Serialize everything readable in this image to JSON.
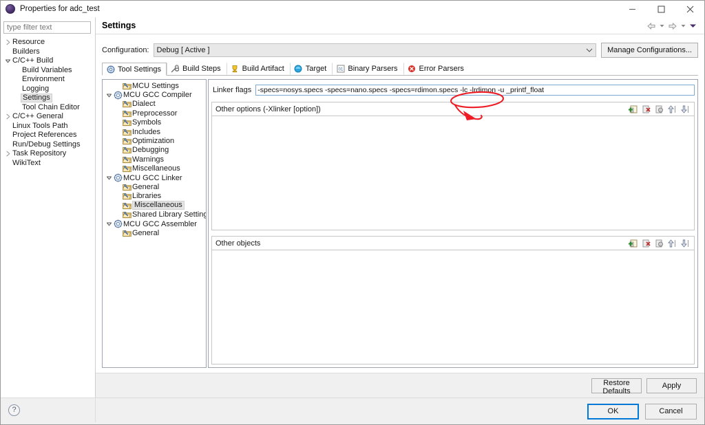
{
  "window": {
    "title": "Properties for adc_test",
    "icon": "eclipse-circle-icon",
    "controls": {
      "minimize": "minimize-icon",
      "maximize": "maximize-icon",
      "close": "close-icon"
    }
  },
  "sidebar": {
    "filter": {
      "placeholder": "type filter text",
      "value": ""
    },
    "items": [
      {
        "label": "Resource",
        "indent": 0,
        "twisty": "collapsed",
        "selected": false
      },
      {
        "label": "Builders",
        "indent": 0,
        "twisty": "none",
        "selected": false
      },
      {
        "label": "C/C++ Build",
        "indent": 0,
        "twisty": "expanded",
        "selected": false
      },
      {
        "label": "Build Variables",
        "indent": 1,
        "twisty": "none",
        "selected": false
      },
      {
        "label": "Environment",
        "indent": 1,
        "twisty": "none",
        "selected": false
      },
      {
        "label": "Logging",
        "indent": 1,
        "twisty": "none",
        "selected": false
      },
      {
        "label": "Settings",
        "indent": 1,
        "twisty": "none",
        "selected": true
      },
      {
        "label": "Tool Chain Editor",
        "indent": 1,
        "twisty": "none",
        "selected": false
      },
      {
        "label": "C/C++ General",
        "indent": 0,
        "twisty": "collapsed",
        "selected": false
      },
      {
        "label": "Linux Tools Path",
        "indent": 0,
        "twisty": "none",
        "selected": false
      },
      {
        "label": "Project References",
        "indent": 0,
        "twisty": "none",
        "selected": false
      },
      {
        "label": "Run/Debug Settings",
        "indent": 0,
        "twisty": "none",
        "selected": false
      },
      {
        "label": "Task Repository",
        "indent": 0,
        "twisty": "collapsed",
        "selected": false
      },
      {
        "label": "WikiText",
        "indent": 0,
        "twisty": "none",
        "selected": false
      }
    ],
    "help_icon": "help-question-icon"
  },
  "page": {
    "title": "Settings",
    "nav": {
      "back_icon": "arrow-left-icon",
      "back_menu_icon": "chevron-down-icon",
      "forward_icon": "arrow-right-icon",
      "forward_menu_icon": "chevron-down-icon",
      "menu_icon": "chevron-down-filled-icon"
    }
  },
  "configuration": {
    "label": "Configuration:",
    "value": "Debug  [ Active ]",
    "dropdown_icon": "chevron-down-icon",
    "manage_button": "Manage Configurations..."
  },
  "tabs": [
    {
      "label": "Tool Settings",
      "icon": "tool-settings-icon",
      "active": true
    },
    {
      "label": "Build Steps",
      "icon": "wrench-icon",
      "active": false
    },
    {
      "label": "Build Artifact",
      "icon": "trophy-icon",
      "active": false
    },
    {
      "label": "Target",
      "icon": "target-icon",
      "active": false
    },
    {
      "label": "Binary Parsers",
      "icon": "binary-parsers-icon",
      "active": false
    },
    {
      "label": "Error Parsers",
      "icon": "error-parsers-icon",
      "active": false
    }
  ],
  "tool_tree": [
    {
      "label": "MCU Settings",
      "indent": 1,
      "twisty": "none",
      "icon": "folder-tool-icon",
      "selected": false
    },
    {
      "label": "MCU GCC Compiler",
      "indent": 0,
      "twisty": "expanded",
      "icon": "gear-tool-icon",
      "selected": false
    },
    {
      "label": "Dialect",
      "indent": 1,
      "twisty": "none",
      "icon": "folder-tool-icon",
      "selected": false
    },
    {
      "label": "Preprocessor",
      "indent": 1,
      "twisty": "none",
      "icon": "folder-tool-icon",
      "selected": false
    },
    {
      "label": "Symbols",
      "indent": 1,
      "twisty": "none",
      "icon": "folder-tool-icon",
      "selected": false
    },
    {
      "label": "Includes",
      "indent": 1,
      "twisty": "none",
      "icon": "folder-tool-icon",
      "selected": false
    },
    {
      "label": "Optimization",
      "indent": 1,
      "twisty": "none",
      "icon": "folder-tool-icon",
      "selected": false
    },
    {
      "label": "Debugging",
      "indent": 1,
      "twisty": "none",
      "icon": "folder-tool-icon",
      "selected": false
    },
    {
      "label": "Warnings",
      "indent": 1,
      "twisty": "none",
      "icon": "folder-tool-icon",
      "selected": false
    },
    {
      "label": "Miscellaneous",
      "indent": 1,
      "twisty": "none",
      "icon": "folder-tool-icon",
      "selected": false
    },
    {
      "label": "MCU GCC Linker",
      "indent": 0,
      "twisty": "expanded",
      "icon": "gear-tool-icon",
      "selected": false
    },
    {
      "label": "General",
      "indent": 1,
      "twisty": "none",
      "icon": "folder-tool-icon",
      "selected": false
    },
    {
      "label": "Libraries",
      "indent": 1,
      "twisty": "none",
      "icon": "folder-tool-icon",
      "selected": false
    },
    {
      "label": "Miscellaneous",
      "indent": 1,
      "twisty": "none",
      "icon": "folder-tool-icon",
      "selected": true
    },
    {
      "label": "Shared Library Settings",
      "indent": 1,
      "twisty": "none",
      "icon": "folder-tool-icon",
      "selected": false
    },
    {
      "label": "MCU GCC Assembler",
      "indent": 0,
      "twisty": "expanded",
      "icon": "gear-tool-icon",
      "selected": false
    },
    {
      "label": "General",
      "indent": 1,
      "twisty": "none",
      "icon": "folder-tool-icon",
      "selected": false
    }
  ],
  "options": {
    "linker_flags": {
      "label": "Linker flags",
      "value": "-specs=nosys.specs -specs=nano.specs -specs=rdimon.specs -lc -lrdimon -u _printf_float"
    },
    "other_options": {
      "title": "Other options (-Xlinker [option])",
      "entries": []
    },
    "other_objects": {
      "title": "Other objects",
      "entries": []
    },
    "toolbar_icons": [
      "add-icon",
      "delete-icon",
      "edit-icon",
      "move-up-icon",
      "move-down-icon"
    ]
  },
  "footer": {
    "restore_defaults": "Restore Defaults",
    "apply": "Apply",
    "ok": "OK",
    "cancel": "Cancel"
  },
  "annotation": {
    "shape": "red-ellipse-with-arrow",
    "color": "#ee1c25",
    "targets": "-u _printf_float"
  }
}
